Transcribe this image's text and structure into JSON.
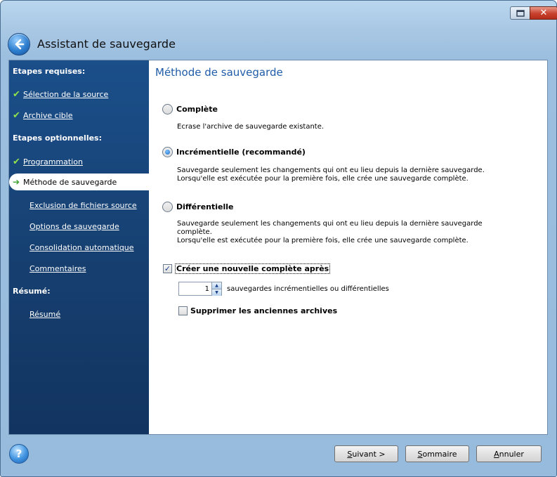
{
  "window": {
    "title": "Assistant de sauvegarde",
    "close_glyph": "✕"
  },
  "icons": {
    "back": "back-arrow-icon",
    "help": "help-icon",
    "done": "checkmark-icon",
    "current": "current-step-arrow-icon"
  },
  "sidebar": {
    "required_heading": "Etapes requises:",
    "required_items": [
      {
        "label": "Sélection de la source",
        "done": true
      },
      {
        "label": "Archive cible",
        "done": true
      }
    ],
    "optional_heading": "Etapes optionnelles:",
    "optional_items": [
      {
        "label": "Programmation",
        "done": true
      },
      {
        "label": "Méthode de sauvegarde",
        "active": true
      },
      {
        "label": "Exclusion de fichiers source"
      },
      {
        "label": "Options de sauvegarde"
      },
      {
        "label": "Consolidation automatique"
      },
      {
        "label": "Commentaires"
      }
    ],
    "summary_heading": "Résumé:",
    "summary_item": "Résumé"
  },
  "main": {
    "title": "Méthode de sauvegarde",
    "options": [
      {
        "label": "Complète",
        "selected": false,
        "desc": [
          "Ecrase l'archive de sauvegarde existante."
        ]
      },
      {
        "label": "Incrémentielle (recommandé)",
        "selected": true,
        "desc": [
          "Sauvegarde seulement les changements qui ont eu lieu depuis la dernière sauvegarde.",
          "Lorsqu'elle est exécutée pour la première fois, elle crée une sauvegarde complète."
        ]
      },
      {
        "label": "Différentielle",
        "selected": false,
        "desc": [
          "Sauvegarde seulement les changements qui ont eu lieu depuis la dernière sauvegarde complète.",
          "Lorsqu'elle est exécutée pour la première fois, elle crée une sauvegarde complète."
        ]
      }
    ],
    "create_full": {
      "label": "Créer une nouvelle complète après",
      "checked": true
    },
    "spinner": {
      "value": "1",
      "label": "sauvegardes incrémentielles ou différentielles"
    },
    "delete_old": {
      "label": "Supprimer les anciennes archives",
      "checked": false
    }
  },
  "footer": {
    "help_glyph": "?",
    "next": {
      "mnemonic": "S",
      "rest": "uivant >"
    },
    "summary": {
      "mnemonic": "S",
      "rest": "ommaire"
    },
    "cancel": {
      "mnemonic": "A",
      "rest": "nnuler"
    }
  },
  "colors": {
    "sidebar_bg": "#163f70",
    "title_accent": "#1f5ca8",
    "check_green": "#8fe24b"
  }
}
